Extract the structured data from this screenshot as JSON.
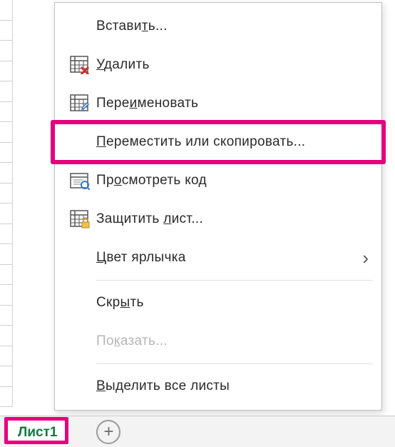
{
  "tabbar": {
    "active_sheet": "Лист1"
  },
  "menu": {
    "insert": "Вставить...",
    "delete": "Удалить",
    "rename": "Переименовать",
    "move_copy": "Переместить или скопировать...",
    "view_code": "Просмотреть код",
    "protect": "Защитить лист...",
    "tab_color": "Цвет ярлычка",
    "hide": "Скрыть",
    "show": "Показать...",
    "select_all": "Выделить все листы"
  },
  "underline_hints": {
    "insert": "ь",
    "delete": "У",
    "rename": "и",
    "move_copy": "П",
    "view_code": "о",
    "protect": "л",
    "tab_color": "Ц",
    "hide": "ы",
    "show": "к",
    "select_all": "В"
  }
}
